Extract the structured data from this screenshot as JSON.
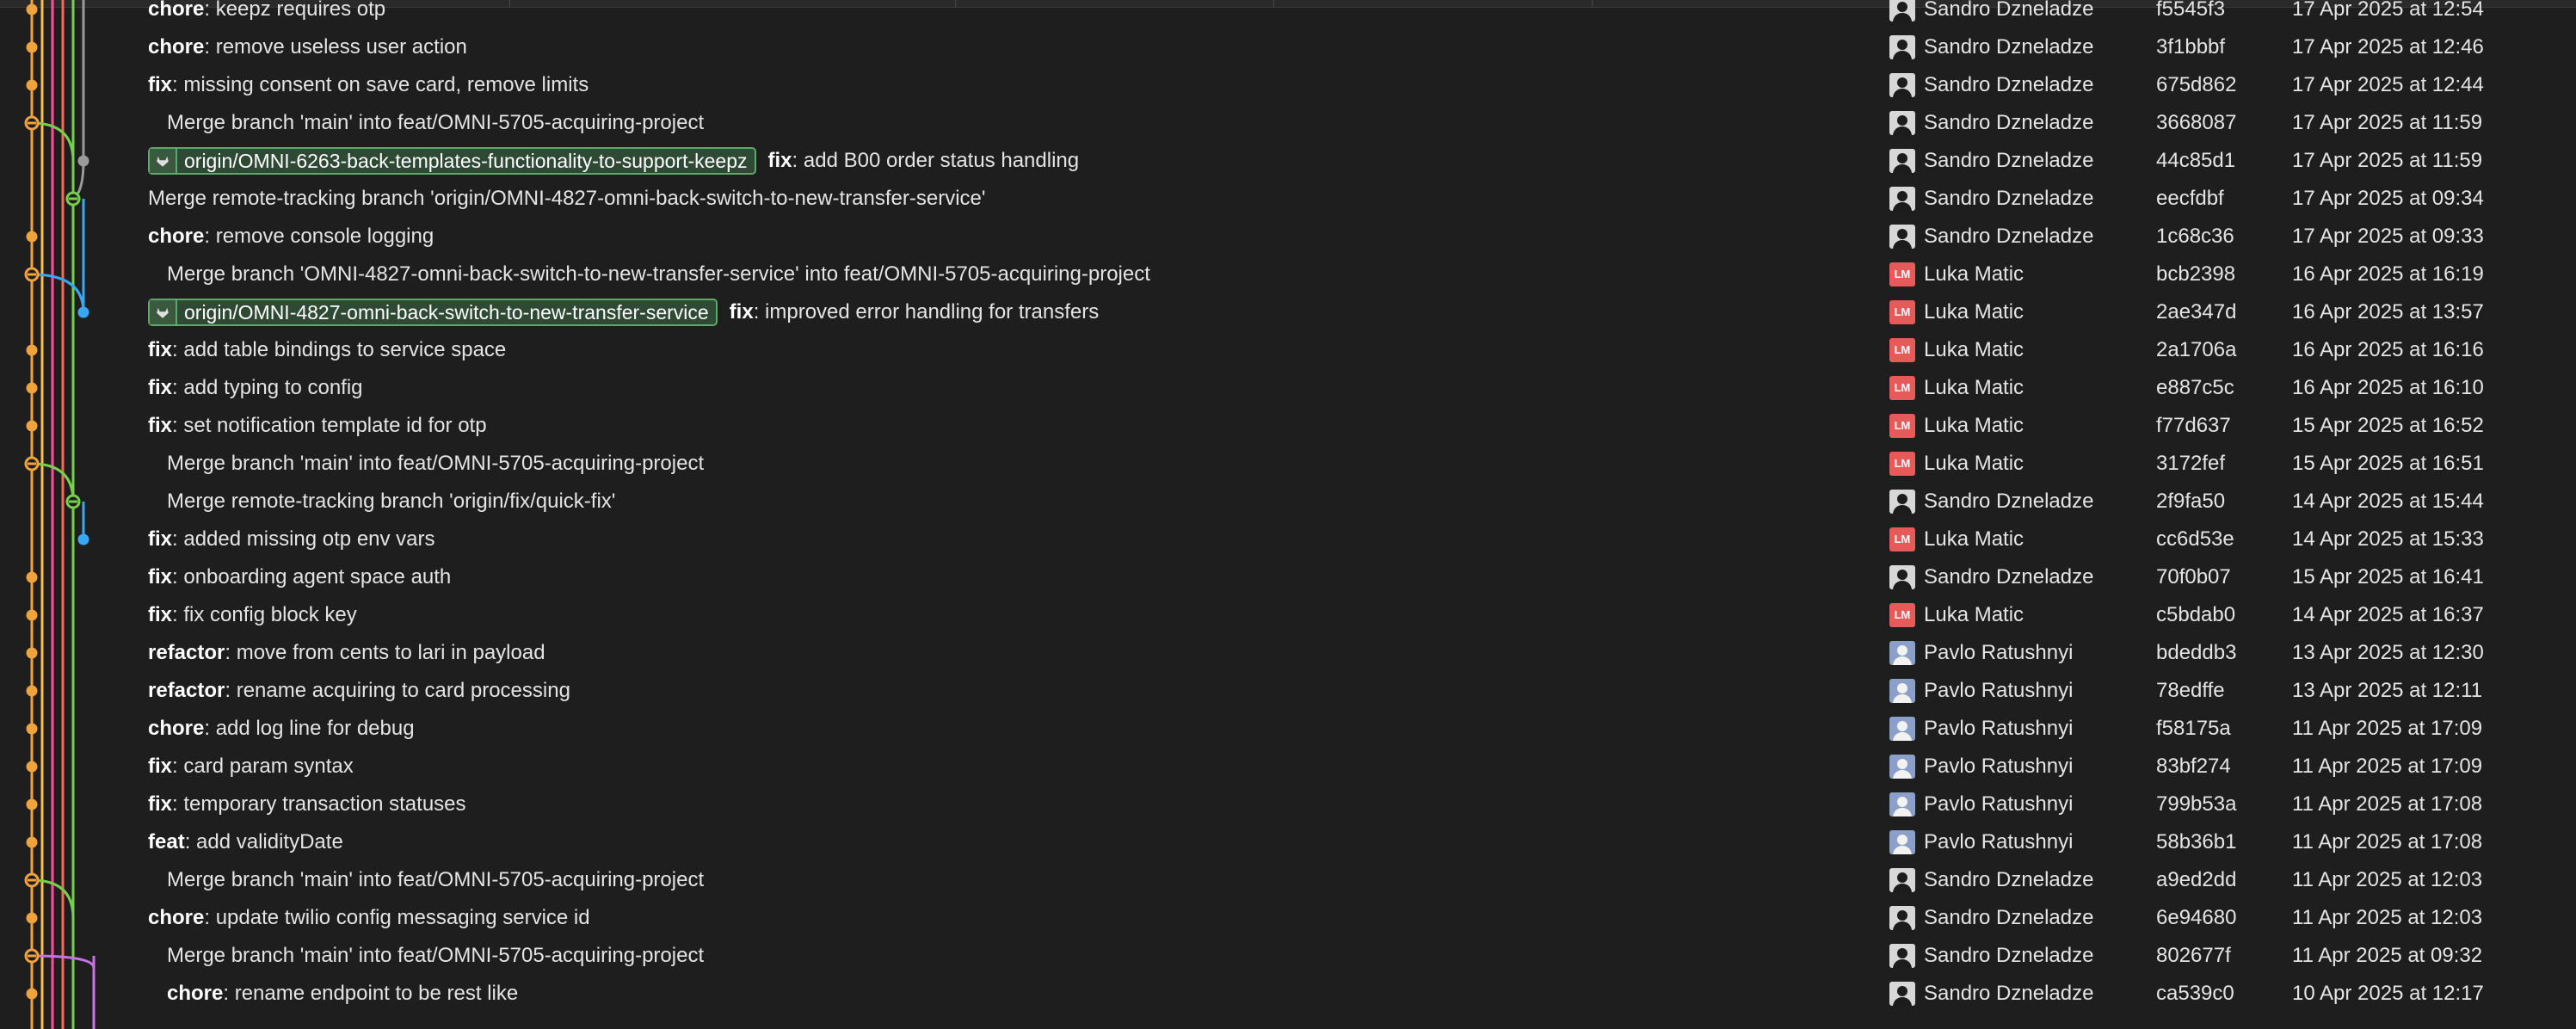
{
  "graph": {
    "lane_colors": [
      "#f0a33b",
      "#f5c242",
      "#ff4f9a",
      "#f26a5a",
      "#76d04b",
      "#3aa7f5",
      "#c772e6",
      "#9a9a9a"
    ]
  },
  "commits": [
    {
      "type": "chore",
      "text": "keepz requires otp",
      "ref": "",
      "author": "Sandro Dzneladze",
      "avatar": "photo-sd",
      "initials": "",
      "sha": "f5545f3",
      "date": "17 Apr 2025 at 12:54"
    },
    {
      "type": "chore",
      "text": "remove useless user action",
      "ref": "",
      "author": "Sandro Dzneladze",
      "avatar": "photo-sd",
      "initials": "",
      "sha": "3f1bbbf",
      "date": "17 Apr 2025 at 12:46"
    },
    {
      "type": "fix",
      "text": "missing consent on save card, remove limits",
      "ref": "",
      "author": "Sandro Dzneladze",
      "avatar": "photo-sd",
      "initials": "",
      "sha": "675d862",
      "date": "17 Apr 2025 at 12:44"
    },
    {
      "type": "",
      "text": "Merge branch 'main' into feat/OMNI-5705-acquiring-project",
      "ref": "",
      "author": "Sandro Dzneladze",
      "avatar": "photo-sd",
      "initials": "",
      "sha": "3668087",
      "date": "17 Apr 2025 at 11:59"
    },
    {
      "type": "fix",
      "text": "add B00 order status handling",
      "ref": "origin/OMNI-6263-back-templates-functionality-to-support-keepz",
      "author": "Sandro Dzneladze",
      "avatar": "photo-sd",
      "initials": "",
      "sha": "44c85d1",
      "date": "17 Apr 2025 at 11:59"
    },
    {
      "type": "",
      "text": "Merge remote-tracking branch 'origin/OMNI-4827-omni-back-switch-to-new-transfer-service'",
      "ref": "",
      "author": "Sandro Dzneladze",
      "avatar": "photo-sd",
      "initials": "",
      "sha": "eecfdbf",
      "date": "17 Apr 2025 at 09:34"
    },
    {
      "type": "chore",
      "text": "remove console logging",
      "ref": "",
      "author": "Sandro Dzneladze",
      "avatar": "photo-sd",
      "initials": "",
      "sha": "1c68c36",
      "date": "17 Apr 2025 at 09:33"
    },
    {
      "type": "",
      "text": "Merge branch 'OMNI-4827-omni-back-switch-to-new-transfer-service' into feat/OMNI-5705-acquiring-project",
      "ref": "",
      "author": "Luka Matic",
      "avatar": "initials",
      "initials": "LM",
      "sha": "bcb2398",
      "date": "16 Apr 2025 at 16:19"
    },
    {
      "type": "fix",
      "text": "improved error handling for transfers",
      "ref": "origin/OMNI-4827-omni-back-switch-to-new-transfer-service",
      "author": "Luka Matic",
      "avatar": "initials",
      "initials": "LM",
      "sha": "2ae347d",
      "date": "16 Apr 2025 at 13:57"
    },
    {
      "type": "fix",
      "text": "add table bindings to service space",
      "ref": "",
      "author": "Luka Matic",
      "avatar": "initials",
      "initials": "LM",
      "sha": "2a1706a",
      "date": "16 Apr 2025 at 16:16"
    },
    {
      "type": "fix",
      "text": "add typing to config",
      "ref": "",
      "author": "Luka Matic",
      "avatar": "initials",
      "initials": "LM",
      "sha": "e887c5c",
      "date": "16 Apr 2025 at 16:10"
    },
    {
      "type": "fix",
      "text": "set notification template id for otp",
      "ref": "",
      "author": "Luka Matic",
      "avatar": "initials",
      "initials": "LM",
      "sha": "f77d637",
      "date": "15 Apr 2025 at 16:52"
    },
    {
      "type": "",
      "text": "Merge branch 'main' into feat/OMNI-5705-acquiring-project",
      "ref": "",
      "author": "Luka Matic",
      "avatar": "initials",
      "initials": "LM",
      "sha": "3172fef",
      "date": "15 Apr 2025 at 16:51"
    },
    {
      "type": "",
      "text": "Merge remote-tracking branch 'origin/fix/quick-fix'",
      "ref": "",
      "author": "Sandro Dzneladze",
      "avatar": "photo-sd",
      "initials": "",
      "sha": "2f9fa50",
      "date": "14 Apr 2025 at 15:44"
    },
    {
      "type": "fix",
      "text": "added missing otp env vars",
      "ref": "",
      "author": "Luka Matic",
      "avatar": "initials",
      "initials": "LM",
      "sha": "cc6d53e",
      "date": "14 Apr 2025 at 15:33"
    },
    {
      "type": "fix",
      "text": "onboarding agent space auth",
      "ref": "",
      "author": "Sandro Dzneladze",
      "avatar": "photo-sd",
      "initials": "",
      "sha": "70f0b07",
      "date": "15 Apr 2025 at 16:41"
    },
    {
      "type": "fix",
      "text": "fix config block key",
      "ref": "",
      "author": "Luka Matic",
      "avatar": "initials",
      "initials": "LM",
      "sha": "c5bdab0",
      "date": "14 Apr 2025 at 16:37"
    },
    {
      "type": "refactor",
      "text": "move from cents to lari in payload",
      "ref": "",
      "author": "Pavlo Ratushnyi",
      "avatar": "photo-pr",
      "initials": "",
      "sha": "bdeddb3",
      "date": "13 Apr 2025 at 12:30"
    },
    {
      "type": "refactor",
      "text": "rename acquiring to card processing",
      "ref": "",
      "author": "Pavlo Ratushnyi",
      "avatar": "photo-pr",
      "initials": "",
      "sha": "78edffe",
      "date": "13 Apr 2025 at 12:11"
    },
    {
      "type": "chore",
      "text": "add log line for debug",
      "ref": "",
      "author": "Pavlo Ratushnyi",
      "avatar": "photo-pr",
      "initials": "",
      "sha": "f58175a",
      "date": "11 Apr 2025 at 17:09"
    },
    {
      "type": "fix",
      "text": "card param syntax",
      "ref": "",
      "author": "Pavlo Ratushnyi",
      "avatar": "photo-pr",
      "initials": "",
      "sha": "83bf274",
      "date": "11 Apr 2025 at 17:09"
    },
    {
      "type": "fix",
      "text": "temporary transaction statuses",
      "ref": "",
      "author": "Pavlo Ratushnyi",
      "avatar": "photo-pr",
      "initials": "",
      "sha": "799b53a",
      "date": "11 Apr 2025 at 17:08"
    },
    {
      "type": "feat",
      "text": "add validityDate",
      "ref": "",
      "author": "Pavlo Ratushnyi",
      "avatar": "photo-pr",
      "initials": "",
      "sha": "58b36b1",
      "date": "11 Apr 2025 at 17:08"
    },
    {
      "type": "",
      "text": "Merge branch 'main' into feat/OMNI-5705-acquiring-project",
      "ref": "",
      "author": "Sandro Dzneladze",
      "avatar": "photo-sd",
      "initials": "",
      "sha": "a9ed2dd",
      "date": "11 Apr 2025 at 12:03"
    },
    {
      "type": "chore",
      "text": "update twilio config messaging service id",
      "ref": "",
      "author": "Sandro Dzneladze",
      "avatar": "photo-sd",
      "initials": "",
      "sha": "6e94680",
      "date": "11 Apr 2025 at 12:03"
    },
    {
      "type": "",
      "text": "Merge branch 'main' into feat/OMNI-5705-acquiring-project",
      "ref": "",
      "author": "Sandro Dzneladze",
      "avatar": "photo-sd",
      "initials": "",
      "sha": "802677f",
      "date": "11 Apr 2025 at 09:32"
    },
    {
      "type": "chore",
      "text": "rename endpoint to be rest like",
      "ref": "",
      "author": "Sandro Dzneladze",
      "avatar": "photo-sd",
      "initials": "",
      "sha": "ca539c0",
      "date": "10 Apr 2025 at 12:17"
    }
  ]
}
